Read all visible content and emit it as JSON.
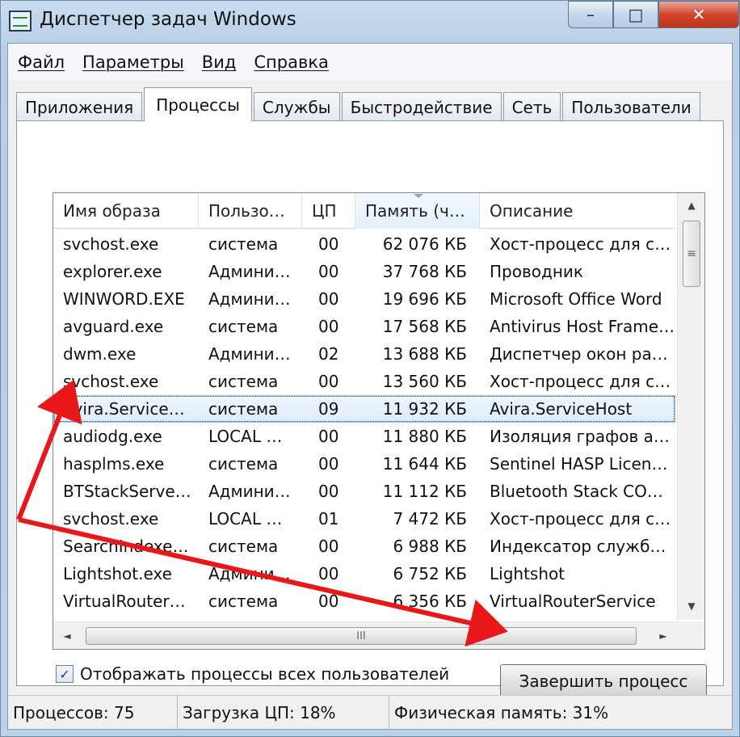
{
  "window": {
    "title": "Диспетчер задач Windows",
    "caption_buttons": {
      "minimize": "–",
      "maximize": "□",
      "close": "✕"
    }
  },
  "menu": [
    "Файл",
    "Параметры",
    "Вид",
    "Справка"
  ],
  "tabs": [
    "Приложения",
    "Процессы",
    "Службы",
    "Быстродействие",
    "Сеть",
    "Пользователи"
  ],
  "active_tab": "Процессы",
  "columns": {
    "image": "Имя образа",
    "user": "Пользо…",
    "cpu": "ЦП",
    "memory": "Память (ч…",
    "description": "Описание"
  },
  "processes": [
    {
      "image": "svchost.exe",
      "user": "система",
      "cpu": "00",
      "memory": "62 076 КБ",
      "description": "Хост-процесс для с…"
    },
    {
      "image": "explorer.exe",
      "user": "Админи…",
      "cpu": "00",
      "memory": "37 768 КБ",
      "description": "Проводник"
    },
    {
      "image": "WINWORD.EXE",
      "user": "Админи…",
      "cpu": "00",
      "memory": "19 696 КБ",
      "description": "Microsoft Office Word"
    },
    {
      "image": "avguard.exe",
      "user": "система",
      "cpu": "00",
      "memory": "17 568 КБ",
      "description": "Antivirus Host Frame…"
    },
    {
      "image": "dwm.exe",
      "user": "Админи…",
      "cpu": "02",
      "memory": "13 688 КБ",
      "description": "Диспетчер окон ра…"
    },
    {
      "image": "svchost.exe",
      "user": "система",
      "cpu": "00",
      "memory": "13 560 КБ",
      "description": "Хост-процесс для с…"
    },
    {
      "image": "Avira.Service…",
      "user": "система",
      "cpu": "09",
      "memory": "11 932 КБ",
      "description": "Avira.ServiceHost",
      "selected": true
    },
    {
      "image": "audiodg.exe",
      "user": "LOCAL …",
      "cpu": "00",
      "memory": "11 880 КБ",
      "description": "Изоляция графов а…"
    },
    {
      "image": "hasplms.exe",
      "user": "система",
      "cpu": "00",
      "memory": "11 644 КБ",
      "description": "Sentinel HASP Licens…"
    },
    {
      "image": "BTStackServe…",
      "user": "Админи…",
      "cpu": "00",
      "memory": "11 112 КБ",
      "description": "Bluetooth Stack CO…"
    },
    {
      "image": "svchost.exe",
      "user": "LOCAL …",
      "cpu": "01",
      "memory": "7 472 КБ",
      "description": "Хост-процесс для с…"
    },
    {
      "image": "SearchIndexe…",
      "user": "система",
      "cpu": "00",
      "memory": "6 988 КБ",
      "description": "Индексатор служб…"
    },
    {
      "image": "Lightshot.exe",
      "user": "Админи…",
      "cpu": "00",
      "memory": "6 752 КБ",
      "description": "Lightshot"
    },
    {
      "image": "VirtualRouter…",
      "user": "система",
      "cpu": "00",
      "memory": "6 356 КБ",
      "description": "VirtualRouterService"
    }
  ],
  "scrollbars": {
    "up": "▲",
    "down": "▼",
    "left": "◄",
    "right": "►",
    "v_grip": "≡",
    "h_grip": "III"
  },
  "show_all_users": {
    "label": "Отображать процессы всех пользователей",
    "checked": true,
    "check_glyph": "✓"
  },
  "end_process_button": "Завершить процесс",
  "status": {
    "processes": "Процессов: 75",
    "cpu": "Загрузка ЦП: 18%",
    "memory": "Физическая память: 31%"
  },
  "colors": {
    "annotation_arrow": "#e8181a",
    "selection": "#dcecfb"
  }
}
